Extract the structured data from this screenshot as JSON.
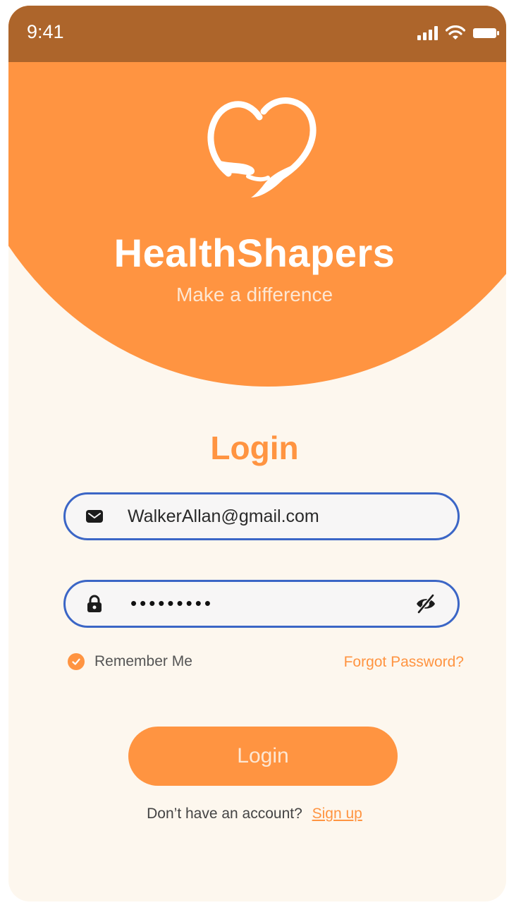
{
  "status_bar": {
    "time": "9:41",
    "icons": [
      "signal-icon",
      "wifi-icon",
      "battery-icon"
    ]
  },
  "header": {
    "logo_icon": "heart-hands-logo",
    "brand_name": "HealthShapers",
    "tagline": "Make a difference"
  },
  "form": {
    "heading": "Login",
    "email": {
      "icon": "mail-icon",
      "value": "WalkerAllan@gmail.com"
    },
    "password": {
      "icon": "lock-icon",
      "masked_value": "•••••••••",
      "toggle_icon": "eye-off-icon"
    },
    "remember_me_label": "Remember Me",
    "remember_me_checked": true,
    "forgot_password_label": "Forgot Password?",
    "login_button_label": "Login",
    "signup_prompt": "Don’t have an account?",
    "signup_link_label": "Sign up"
  },
  "colors": {
    "accent": "#ff9441",
    "status_bar": "#ad652b",
    "background": "#fdf7ee",
    "field_border": "#3b66c6"
  }
}
